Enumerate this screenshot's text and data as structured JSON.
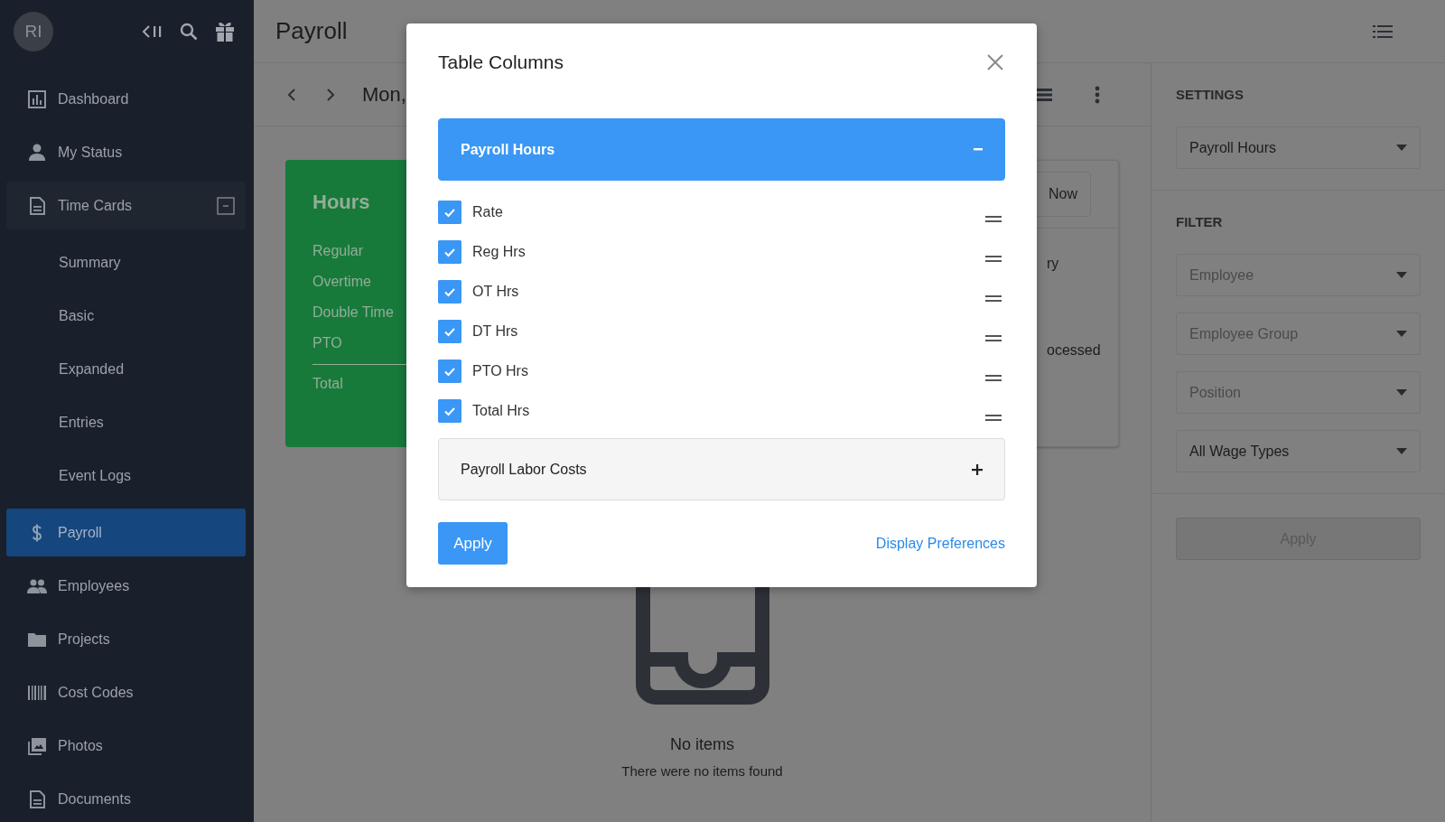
{
  "sidebar": {
    "avatar": "RI",
    "items": [
      {
        "label": "Dashboard",
        "selected": false
      },
      {
        "label": "My Status",
        "selected": false
      },
      {
        "label": "Time Cards",
        "selected": false,
        "expanded": true,
        "children": [
          {
            "label": "Summary",
            "selected": false
          },
          {
            "label": "Basic",
            "selected": false
          },
          {
            "label": "Expanded",
            "selected": false
          },
          {
            "label": "Entries",
            "selected": false
          },
          {
            "label": "Event Logs",
            "selected": false
          }
        ]
      },
      {
        "label": "Payroll",
        "selected": true
      },
      {
        "label": "Employees",
        "selected": false
      },
      {
        "label": "Projects",
        "selected": false
      },
      {
        "label": "Cost Codes",
        "selected": false
      },
      {
        "label": "Photos",
        "selected": false
      },
      {
        "label": "Documents",
        "selected": false
      }
    ]
  },
  "header": {
    "title": "Payroll"
  },
  "toolbar": {
    "date": "Mon,"
  },
  "hours_card": {
    "title": "Hours",
    "rows": [
      "Regular",
      "Overtime",
      "Double Time",
      "PTO"
    ],
    "total": "Total"
  },
  "summary_card": {
    "button": "Now",
    "lines": [
      "ry",
      "ocessed"
    ]
  },
  "empty_state": {
    "title": "No items",
    "message": "There were no items found"
  },
  "settings": {
    "heading": "SETTINGS",
    "report": {
      "value": "Payroll Hours"
    }
  },
  "filter": {
    "heading": "FILTER",
    "fields": [
      {
        "placeholder": "Employee"
      },
      {
        "placeholder": "Employee Group"
      },
      {
        "placeholder": "Position"
      },
      {
        "value": "All Wage Types"
      }
    ],
    "apply": {
      "label": "Apply",
      "disabled": true
    }
  },
  "modal": {
    "title": "Table Columns",
    "sections": [
      {
        "title": "Payroll Hours",
        "expanded": true,
        "columns": [
          {
            "label": "Rate",
            "checked": true
          },
          {
            "label": "Reg Hrs",
            "checked": true
          },
          {
            "label": "OT Hrs",
            "checked": true
          },
          {
            "label": "DT Hrs",
            "checked": true
          },
          {
            "label": "PTO Hrs",
            "checked": true
          },
          {
            "label": "Total Hrs",
            "checked": true
          }
        ]
      },
      {
        "title": "Payroll Labor Costs",
        "expanded": false
      }
    ],
    "apply": "Apply",
    "link": "Display Preferences"
  }
}
